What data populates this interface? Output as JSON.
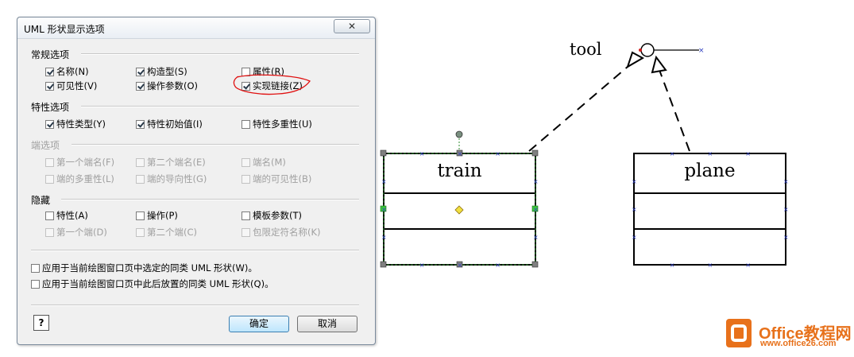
{
  "dialog": {
    "title": "UML 形状显示选项",
    "close_label": "✕",
    "sections": {
      "general": "常规选项",
      "attributes": "特性选项",
      "ends": "端选项",
      "hide": "隐藏"
    },
    "general": {
      "name": "名称(N)",
      "stereotype": "构造型(S)",
      "properties": "属性(R)",
      "visibility": "可见性(V)",
      "op_params": "操作参数(O)",
      "realize_link": "实现链接(Z)"
    },
    "attributes": {
      "type": "特性类型(Y)",
      "initial": "特性初始值(I)",
      "multiplicity": "特性多重性(U)"
    },
    "ends": {
      "first_end_name": "第一个端名(F)",
      "second_end_name": "第二个端名(E)",
      "end_name": "端名(M)",
      "end_multiplicity": "端的多重性(L)",
      "end_navigability": "端的导向性(G)",
      "end_visibility": "端的可见性(B)"
    },
    "hide": {
      "attributes": "特性(A)",
      "operations": "操作(P)",
      "template_params": "模板参数(T)",
      "first_end": "第一个端(D)",
      "second_end": "第二个端(C)",
      "qualifier": "包限定符名称(K)"
    },
    "apply_selected": "应用于当前绘图窗口页中选定的同类 UML 形状(W)。",
    "apply_future": "应用于当前绘图窗口页中此后放置的同类 UML 形状(Q)。",
    "help_label": "?",
    "ok_label": "确定",
    "cancel_label": "取消"
  },
  "diagram": {
    "interface_label": "tool",
    "class_train": "train",
    "class_plane": "plane",
    "line_color": "#000000",
    "selection_color": "#2e8b2e",
    "annotation_color": "#e01010"
  },
  "watermark": {
    "brand": "Office教程网",
    "url": "www.office26.com",
    "brand_color": "#e7711b"
  }
}
